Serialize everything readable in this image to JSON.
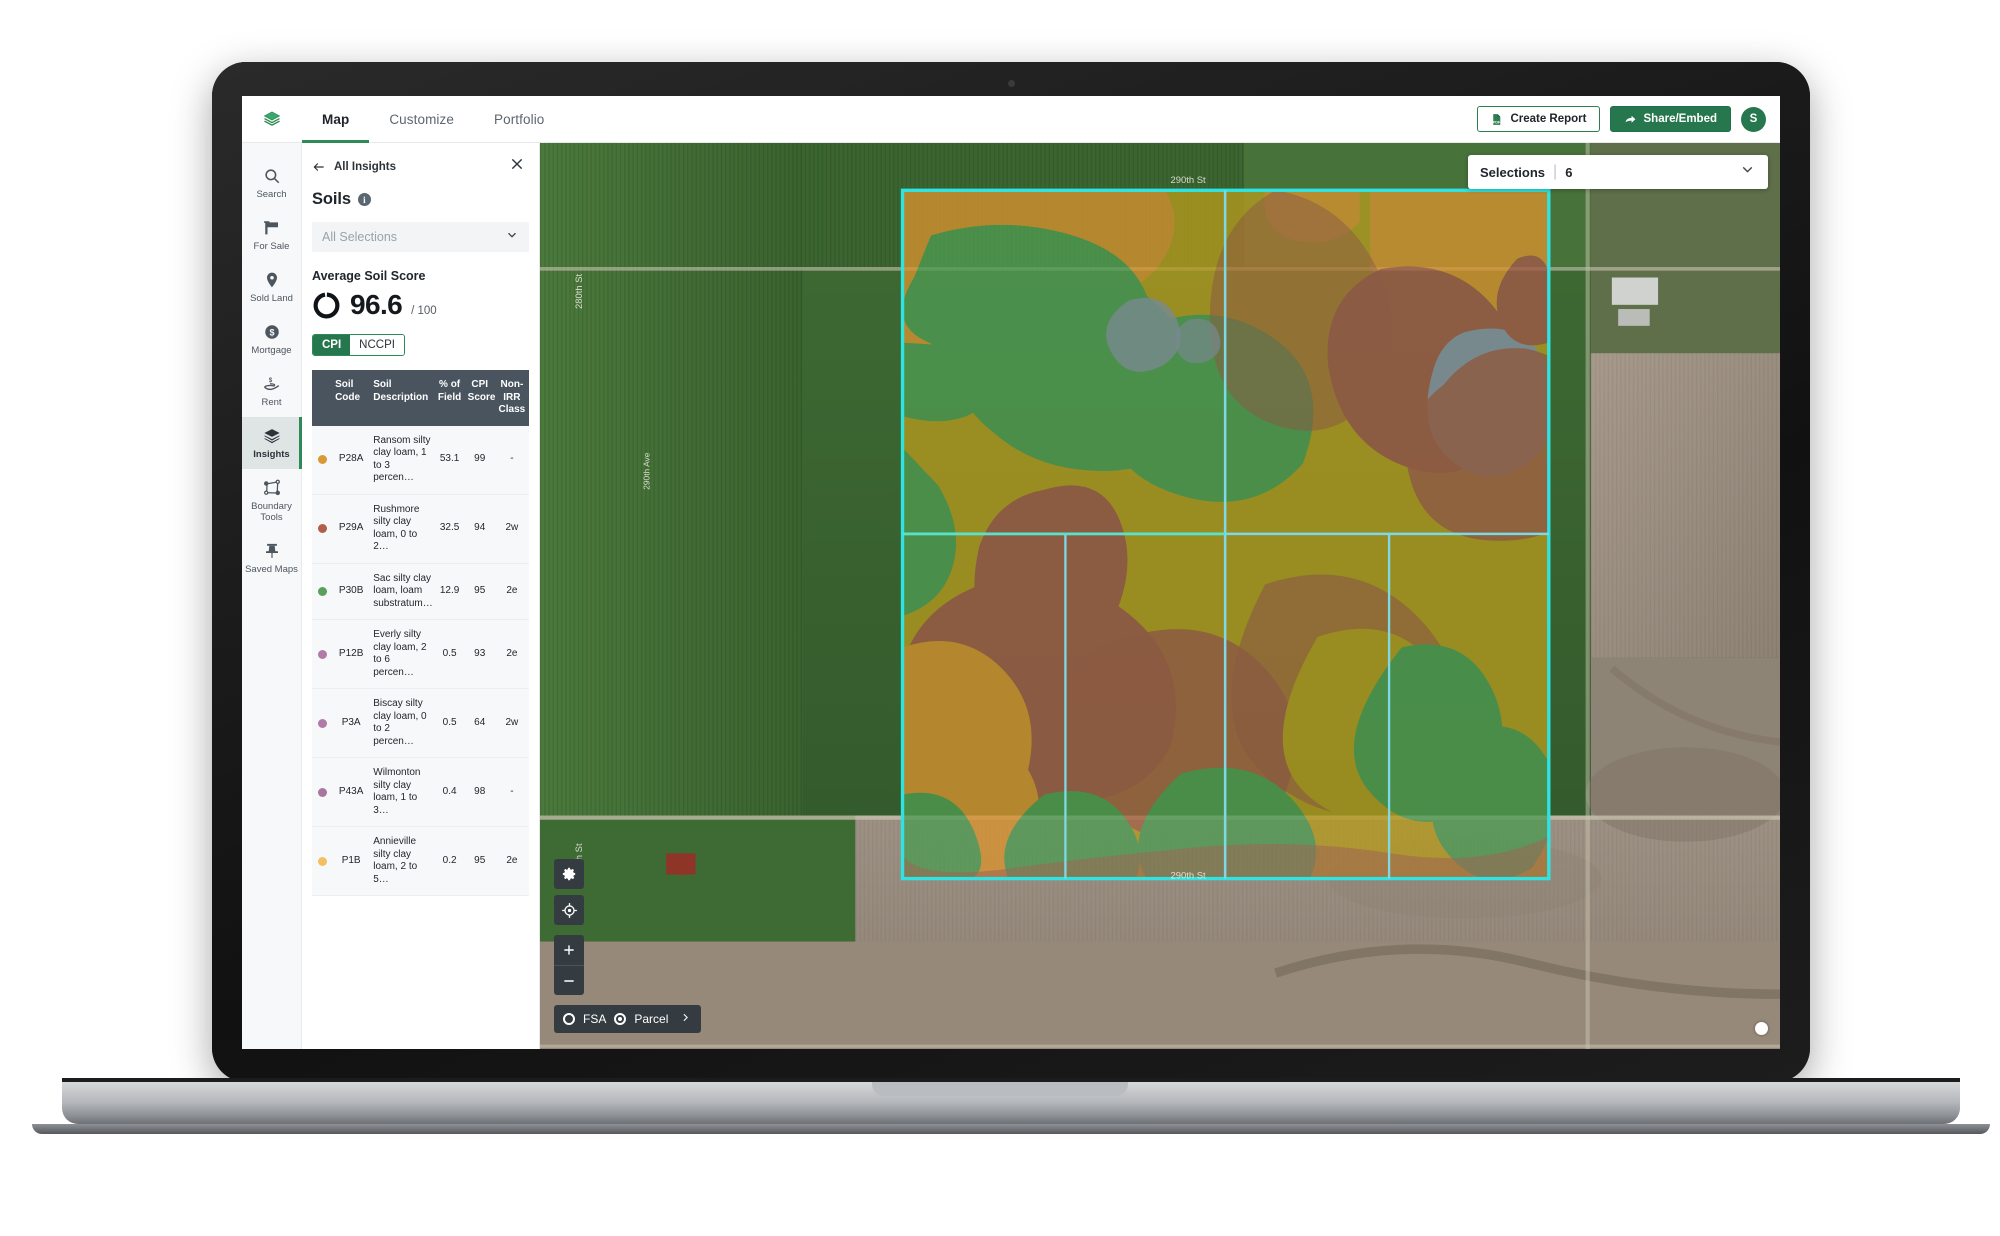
{
  "app": {
    "logo_icon": "layers-logo-icon"
  },
  "tabs": [
    {
      "label": "Map",
      "active": true
    },
    {
      "label": "Customize",
      "active": false
    },
    {
      "label": "Portfolio",
      "active": false
    }
  ],
  "topbar": {
    "create_report_label": "Create Report",
    "create_report_icon": "pdf-document-icon",
    "share_embed_label": "Share/Embed",
    "share_embed_icon": "share-arrow-icon",
    "avatar_initial": "S",
    "accent_green": "#26774d"
  },
  "rail": {
    "items": [
      {
        "label": "Search",
        "icon": "search-icon",
        "active": false
      },
      {
        "label": "For Sale",
        "icon": "for-sale-sign-icon",
        "active": false
      },
      {
        "label": "Sold Land",
        "icon": "map-pin-icon",
        "active": false
      },
      {
        "label": "Mortgage",
        "icon": "dollar-circle-icon",
        "active": false
      },
      {
        "label": "Rent",
        "icon": "hand-money-icon",
        "active": false
      },
      {
        "label": "Insights",
        "icon": "layers-stack-icon",
        "active": true
      },
      {
        "label": "Boundary Tools",
        "icon": "boundary-nodes-icon",
        "active": false
      },
      {
        "label": "Saved Maps",
        "icon": "pushpin-icon",
        "active": false
      }
    ]
  },
  "panel": {
    "back_label": "All Insights",
    "back_icon": "arrow-left-icon",
    "close_icon": "close-icon",
    "title": "Soils",
    "info_icon": "info-icon",
    "selector_value": "All Selections",
    "selector_chevron": "chevron-down-icon",
    "score_label": "Average Soil Score",
    "score_value": "96.6",
    "score_max": "/ 100",
    "segmented": [
      {
        "label": "CPI",
        "selected": true
      },
      {
        "label": "NCCPI",
        "selected": false
      }
    ],
    "table": {
      "columns": [
        "Soil Code",
        "Soil Description",
        "% of Field",
        "CPI Score",
        "Non-IRR Class"
      ],
      "rows": [
        {
          "color": "#d99a35",
          "code": "P28A",
          "desc": "Ransom silty clay loam, 1 to 3 percen…",
          "pct": "53.1",
          "cpi": "99",
          "cls": "-"
        },
        {
          "color": "#b15e4a",
          "code": "P29A",
          "desc": "Rushmore silty clay loam, 0 to 2…",
          "pct": "32.5",
          "cpi": "94",
          "cls": "2w"
        },
        {
          "color": "#58a05c",
          "code": "P30B",
          "desc": "Sac silty clay loam, loam substratum…",
          "pct": "12.9",
          "cpi": "95",
          "cls": "2e"
        },
        {
          "color": "#b07ba6",
          "code": "P12B",
          "desc": "Everly silty clay loam, 2 to 6 percen…",
          "pct": "0.5",
          "cpi": "93",
          "cls": "2e"
        },
        {
          "color": "#b07ba6",
          "code": "P3A",
          "desc": "Biscay silty clay loam, 0 to 2 percen…",
          "pct": "0.5",
          "cpi": "64",
          "cls": "2w"
        },
        {
          "color": "#a877a0",
          "code": "P43A",
          "desc": "Wilmonton silty clay loam, 1 to 3…",
          "pct": "0.4",
          "cpi": "98",
          "cls": "-"
        },
        {
          "color": "#f2c060",
          "code": "P1B",
          "desc": "Annieville silty clay loam, 2 to 5…",
          "pct": "0.2",
          "cpi": "95",
          "cls": "2e"
        }
      ]
    }
  },
  "map": {
    "selections_label": "Selections",
    "selections_count": "6",
    "selections_chevron": "chevron-down-icon",
    "controls": [
      {
        "icon": "gear-icon",
        "name": "map-settings-button"
      },
      {
        "icon": "crosshair-locate-icon",
        "name": "locate-button"
      },
      {
        "icon": "plus-icon",
        "name": "zoom-in-button"
      },
      {
        "icon": "minus-icon",
        "name": "zoom-out-button"
      }
    ],
    "layer_toggle": [
      {
        "label": "FSA",
        "selected": false
      },
      {
        "label": "Parcel",
        "selected": true
      }
    ],
    "layer_toggle_arrow": "chevron-right-icon",
    "road_labels": [
      "280th St",
      "280th St",
      "290th St",
      "290th St"
    ],
    "boundary_color": "#2fe3e3",
    "soil_colors": {
      "green": "#4f9b52",
      "olive": "#b59a1e",
      "brick": "#a35a48",
      "orange": "#d8932f",
      "slate": "#8a93a8"
    }
  }
}
